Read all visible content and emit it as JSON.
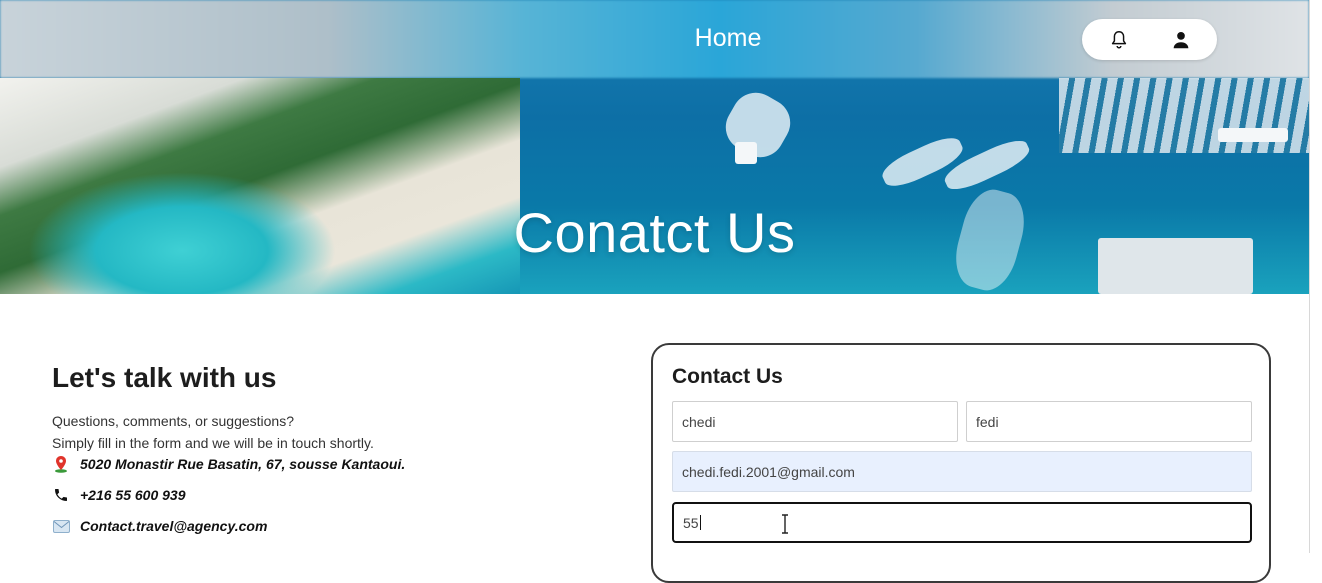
{
  "nav": {
    "title": "Home",
    "notification_icon": "bell-icon",
    "profile_icon": "user-icon"
  },
  "hero": {
    "heading": "Conatct Us"
  },
  "info": {
    "heading": "Let's talk with us",
    "line1": "Questions, comments, or suggestions?",
    "line2": "Simply fill in the form and we will be in touch shortly.",
    "address": "5020 Monastir Rue Basatin, 67, sousse Kantaoui.",
    "address_icon": "map-pin-icon",
    "phone": "+216 55 600 939",
    "phone_icon": "phone-icon",
    "email": "Contact.travel@agency.com",
    "email_icon": "mail-icon"
  },
  "form": {
    "title": "Contact Us",
    "first_name": "chedi",
    "last_name": "fedi",
    "email": "chedi.fedi.2001@gmail.com",
    "phone": "55"
  },
  "colors": {
    "autofill_bg": "#e8f0fe",
    "text_dark": "#1d1d1d"
  }
}
